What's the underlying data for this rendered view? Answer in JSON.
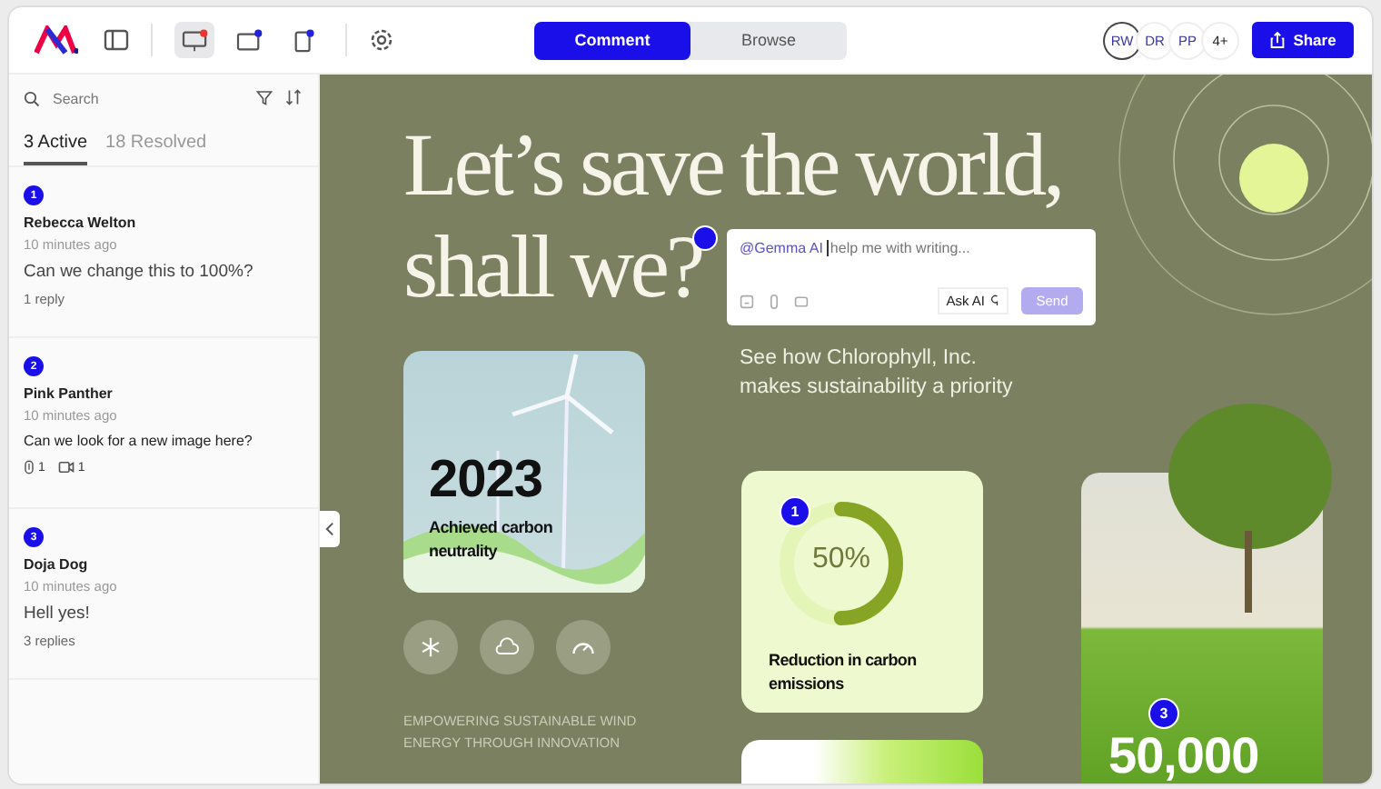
{
  "toolbar": {
    "devices": [
      {
        "kind": "desktop",
        "selected": true
      },
      {
        "kind": "tablet",
        "selected": false
      },
      {
        "kind": "phone",
        "selected": false
      }
    ],
    "modes": [
      {
        "label": "Comment",
        "selected": true
      },
      {
        "label": "Browse",
        "selected": false
      }
    ],
    "collaborators": [
      {
        "initials": "RW",
        "selected": true
      },
      {
        "initials": "DR",
        "selected": false
      },
      {
        "initials": "PP",
        "selected": false
      }
    ],
    "more": "4+",
    "share": "Share"
  },
  "sidebar": {
    "search": {
      "placeholder": "Search"
    },
    "tabs": [
      {
        "label": "3 Active",
        "selected": true
      },
      {
        "label": "18 Resolved",
        "selected": false
      }
    ],
    "comments": [
      {
        "number": "1",
        "author": "Rebecca Welton",
        "time": "10 minutes ago",
        "text": "Can we change this to 100%?",
        "replies": "1 reply"
      },
      {
        "number": "2",
        "author": "Pink Panther",
        "time": "10 minutes ago",
        "text": "Can we look for a new image here?",
        "attachments": [
          {
            "kind": "file",
            "count": "1"
          },
          {
            "kind": "video",
            "count": "1"
          }
        ]
      },
      {
        "number": "3",
        "author": "Doja Dog",
        "time": "10 minutes ago",
        "text": "Hell yes!",
        "replies": "3 replies"
      }
    ]
  },
  "canvas": {
    "headline": [
      "Let’s save the world,",
      "shall we?"
    ],
    "comment_box": {
      "mention": "@Gemma AI",
      "placeholder": "help me with writing...",
      "ask_ai": "Ask AI",
      "send": "Send",
      "send_disabled": true
    },
    "tagline": [
      "See how Chlorophyll, Inc.",
      "makes sustainability a priority"
    ],
    "year_card": {
      "year": "2023",
      "caption": [
        "Achieved carbon",
        "neutrality"
      ]
    },
    "footer": [
      "EMPOWERING SUSTAINABLE WIND",
      "ENERGY THROUGH INNOVATION"
    ],
    "stat_card": {
      "value": "50%",
      "level": 0.5,
      "caption": [
        "Reduction in carbon",
        "emissions"
      ]
    },
    "tree_card": {
      "value": "50,000"
    },
    "pins": [
      {
        "number": "1"
      },
      {
        "number": "3"
      }
    ]
  }
}
